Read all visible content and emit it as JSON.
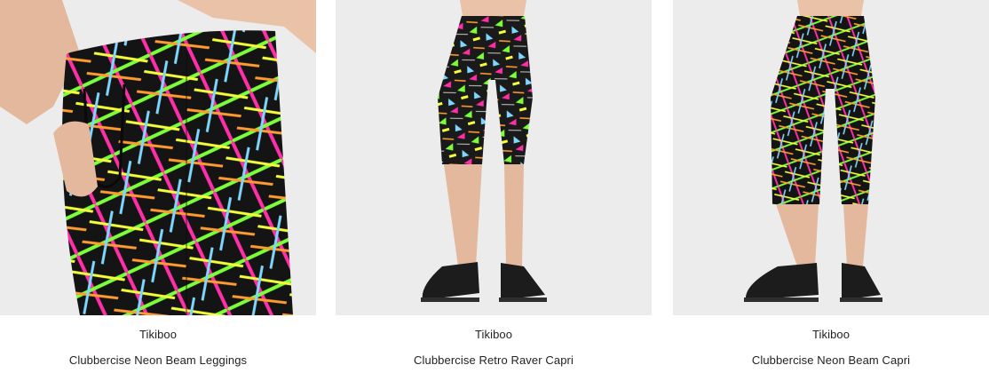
{
  "products": [
    {
      "brand": "Tikiboo",
      "title": "Clubbercise Neon Beam Leggings",
      "image_icon": "neon-beam-leggings-photo"
    },
    {
      "brand": "Tikiboo",
      "title": "Clubbercise Retro Raver Capri",
      "image_icon": "retro-raver-capri-photo"
    },
    {
      "brand": "Tikiboo",
      "title": "Clubbercise Neon Beam Capri",
      "image_icon": "neon-beam-capri-photo"
    }
  ],
  "colors": {
    "background": "#ffffff",
    "photo_background": "#ececec",
    "legging_base": "#141414",
    "neon_pink": "#ff2fa8",
    "neon_green": "#7cff3a",
    "neon_yellow": "#f4ff3a",
    "neon_orange": "#ff9b2f",
    "neon_blue": "#7fd7ff",
    "skin": "#e9c2a8",
    "shoe": "#1c1c1c"
  }
}
